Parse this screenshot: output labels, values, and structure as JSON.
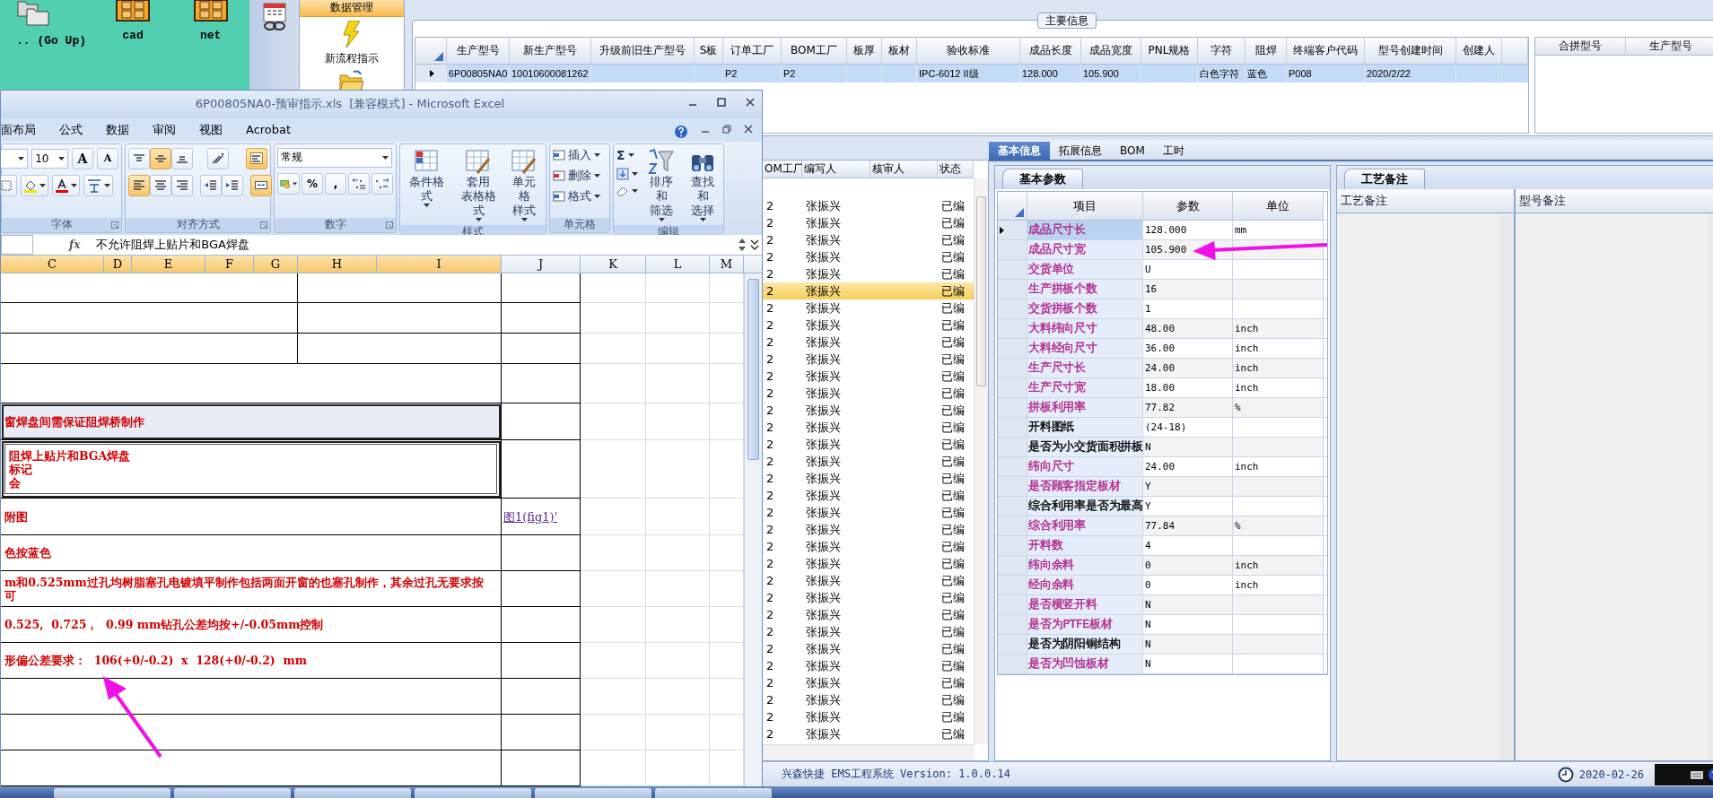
{
  "desktop": {
    "icons": [
      {
        "label": ".. (Go Up)",
        "kind": "folders"
      },
      {
        "label": "cad",
        "kind": "cabinet"
      },
      {
        "label": "net",
        "kind": "cabinet"
      }
    ]
  },
  "nav": {
    "header": "数据管理",
    "items": [
      {
        "label": "新流程指示",
        "kind": "flash"
      },
      {
        "kind": "folder"
      }
    ]
  },
  "main_info": {
    "title": "主要信息",
    "row_selected": true,
    "columns": [
      {
        "label": "生产型号",
        "value": "6P00805NA0"
      },
      {
        "label": "新生产型号",
        "value": "10010600081262"
      },
      {
        "label": "升级前旧生产型号"
      },
      {
        "label": "S板"
      },
      {
        "label": "订单工厂",
        "value": "P2"
      },
      {
        "label": "BOM工厂",
        "value": "P2"
      },
      {
        "label": "板厚"
      },
      {
        "label": "板材"
      },
      {
        "label": "验收标准",
        "value": "IPC-6012 II级"
      },
      {
        "label": "成品长度",
        "value": "128.000"
      },
      {
        "label": "成品宽度",
        "value": "105.900"
      },
      {
        "label": "PNL规格"
      },
      {
        "label": "字符",
        "value": "白色字符"
      },
      {
        "label": "阻焊",
        "value": "蓝色"
      },
      {
        "label": "终端客户代码",
        "value": "P008"
      },
      {
        "label": "型号创建时间",
        "value": "2020/2/22"
      },
      {
        "label": "创建人"
      }
    ]
  },
  "merge_table": {
    "columns": [
      "合拼型号",
      "生产型号"
    ]
  },
  "list": {
    "columns": [
      "OM工厂",
      "编写人",
      "核审人",
      "状态"
    ],
    "rows": [
      {
        "bom": "2",
        "author": "张振兴",
        "status": "已编",
        "selected": false
      },
      {
        "bom": "2",
        "author": "张振兴",
        "status": "已编",
        "selected": false
      },
      {
        "bom": "2",
        "author": "张振兴",
        "status": "已编",
        "selected": false
      },
      {
        "bom": "2",
        "author": "张振兴",
        "status": "已编",
        "selected": false
      },
      {
        "bom": "2",
        "author": "张振兴",
        "status": "已编",
        "selected": false
      },
      {
        "bom": "2",
        "author": "张振兴",
        "status": "已编",
        "selected": true
      },
      {
        "bom": "2",
        "author": "张振兴",
        "status": "已编",
        "selected": false
      },
      {
        "bom": "2",
        "author": "张振兴",
        "status": "已编",
        "selected": false
      },
      {
        "bom": "2",
        "author": "张振兴",
        "status": "已编",
        "selected": false
      },
      {
        "bom": "2",
        "author": "张振兴",
        "status": "已编",
        "selected": false
      },
      {
        "bom": "2",
        "author": "张振兴",
        "status": "已编",
        "selected": false
      },
      {
        "bom": "2",
        "author": "张振兴",
        "status": "已编",
        "selected": false
      },
      {
        "bom": "2",
        "author": "张振兴",
        "status": "已编",
        "selected": false
      },
      {
        "bom": "2",
        "author": "张振兴",
        "status": "已编",
        "selected": false
      },
      {
        "bom": "2",
        "author": "张振兴",
        "status": "已编",
        "selected": false
      },
      {
        "bom": "2",
        "author": "张振兴",
        "status": "已编",
        "selected": false
      },
      {
        "bom": "2",
        "author": "张振兴",
        "status": "已编",
        "selected": false
      },
      {
        "bom": "2",
        "author": "张振兴",
        "status": "已编",
        "selected": false
      },
      {
        "bom": "2",
        "author": "张振兴",
        "status": "已编",
        "selected": false
      },
      {
        "bom": "2",
        "author": "张振兴",
        "status": "已编",
        "selected": false
      },
      {
        "bom": "2",
        "author": "张振兴",
        "status": "已编",
        "selected": false
      },
      {
        "bom": "2",
        "author": "张振兴",
        "status": "已编",
        "selected": false
      },
      {
        "bom": "2",
        "author": "张振兴",
        "status": "已编",
        "selected": false
      },
      {
        "bom": "2",
        "author": "张振兴",
        "status": "已编",
        "selected": false
      },
      {
        "bom": "2",
        "author": "张振兴",
        "status": "已编",
        "selected": false
      },
      {
        "bom": "2",
        "author": "张振兴",
        "status": "已编",
        "selected": false
      },
      {
        "bom": "2",
        "author": "张振兴",
        "status": "已编",
        "selected": false
      },
      {
        "bom": "2",
        "author": "张振兴",
        "status": "已编",
        "selected": false
      },
      {
        "bom": "2",
        "author": "张振兴",
        "status": "已编",
        "selected": false
      },
      {
        "bom": "2",
        "author": "张振兴",
        "status": "已编",
        "selected": false
      },
      {
        "bom": "2",
        "author": "张振兴",
        "status": "已编",
        "selected": false
      },
      {
        "bom": "2",
        "author": "张振兴",
        "status": "已编",
        "selected": false
      }
    ]
  },
  "detail_tabs": [
    {
      "label": "基本信息",
      "selected": true
    },
    {
      "label": "拓展信息",
      "selected": false
    },
    {
      "label": "BOM",
      "selected": false
    },
    {
      "label": "工时",
      "selected": false
    }
  ],
  "params": {
    "tab": "基本参数",
    "columns": [
      "项目",
      "参数",
      "单位"
    ],
    "rows": [
      {
        "name": "成品尺寸长",
        "value": "128.000",
        "unit": "mm",
        "color": "#b0278c",
        "selected": true
      },
      {
        "name": "成品尺寸宽",
        "value": "105.900",
        "color": "#b0278c",
        "selected": false
      },
      {
        "name": "交货单位",
        "value": "U",
        "color": "#b0278c",
        "selected": false
      },
      {
        "name": "生产拼板个数",
        "value": "16",
        "color": "#b0278c",
        "selected": false
      },
      {
        "name": "交货拼板个数",
        "value": "1",
        "color": "#b0278c",
        "selected": false
      },
      {
        "name": "大料纬向尺寸",
        "value": "48.00",
        "unit": "inch",
        "color": "#b0278c",
        "selected": false
      },
      {
        "name": "大料经向尺寸",
        "value": "36.00",
        "unit": "inch",
        "color": "#b0278c",
        "selected": false
      },
      {
        "name": "生产尺寸长",
        "value": "24.00",
        "unit": "inch",
        "color": "#b0278c",
        "selected": false
      },
      {
        "name": "生产尺寸宽",
        "value": "18.00",
        "unit": "inch",
        "color": "#b0278c",
        "selected": false
      },
      {
        "name": "拼板利用率",
        "value": "77.82",
        "unit": "%",
        "color": "#b0278c",
        "selected": false
      },
      {
        "name": "开料图纸",
        "value": "(24-18)",
        "color": "#000000",
        "selected": false
      },
      {
        "name": "是否为小交货面积拼板",
        "value": "N",
        "color": "#000000",
        "selected": false
      },
      {
        "name": "纬向尺寸",
        "value": "24.00",
        "unit": "inch",
        "color": "#b0278c",
        "selected": false
      },
      {
        "name": "是否顾客指定板材",
        "value": "Y",
        "color": "#b0278c",
        "selected": false
      },
      {
        "name": "综合利用率是否为最高",
        "value": "Y",
        "color": "#000000",
        "selected": false
      },
      {
        "name": "综合利用率",
        "value": "77.84",
        "unit": "%",
        "color": "#b0278c",
        "selected": false
      },
      {
        "name": "开料数",
        "value": "4",
        "color": "#b0278c",
        "selected": false
      },
      {
        "name": "纬向余料",
        "value": "0",
        "unit": "inch",
        "color": "#b0278c",
        "selected": false
      },
      {
        "name": "经向余料",
        "value": "0",
        "unit": "inch",
        "color": "#b0278c",
        "selected": false
      },
      {
        "name": "是否横竖开料",
        "value": "N",
        "color": "#b0278c",
        "selected": false
      },
      {
        "name": "是否为PTFE板材",
        "value": "N",
        "color": "#b0278c",
        "selected": false
      },
      {
        "name": "是否为阴阳铜结构",
        "value": "N",
        "color": "#000000",
        "selected": false
      },
      {
        "name": "是否为凹蚀板材",
        "value": "N",
        "color": "#b0278c",
        "selected": false
      }
    ]
  },
  "notes": {
    "tab": "工艺备注",
    "columns": [
      "工艺备注",
      "型号备注"
    ]
  },
  "status_bar": {
    "text": "兴森快捷 EMS工程系统 Version: 1.0.0.14",
    "date": "2020-02-26"
  },
  "excel": {
    "title": "6P00805NA0-预审指示.xls  [兼容模式] - Microsoft Excel",
    "tabs": [
      "面布局",
      "公式",
      "数据",
      "审阅",
      "视图",
      "Acrobat"
    ],
    "groups": [
      {
        "kind": "font",
        "label": "字体"
      },
      {
        "kind": "align",
        "label": "对齐方式"
      },
      {
        "kind": "number",
        "label": "数字"
      },
      {
        "kind": "styles",
        "label": "样式"
      },
      {
        "kind": "cells",
        "label": "单元格"
      },
      {
        "kind": "editing",
        "label": "编辑"
      }
    ],
    "font_size": "10",
    "font_buttons": [
      "A",
      "A"
    ],
    "toggles": [
      {
        "kind": "valign-top",
        "selected": false
      },
      {
        "kind": "valign-middle",
        "selected": true
      },
      {
        "kind": "valign-bottom",
        "selected": false
      },
      {
        "kind": "orientation",
        "selected": false
      },
      {
        "kind": "wrap",
        "selected": true
      },
      {
        "kind": "align-left",
        "selected": true
      },
      {
        "kind": "align-center",
        "selected": false
      },
      {
        "kind": "align-right",
        "selected": false
      },
      {
        "kind": "indent-less",
        "selected": false
      },
      {
        "kind": "indent-more",
        "selected": false
      },
      {
        "kind": "merge",
        "selected": true
      }
    ],
    "number_format": "常规",
    "number_buttons": [
      "%",
      ","
    ],
    "style_buttons": [
      {
        "lines": [
          "条件格式"
        ],
        "kind": "conditional"
      },
      {
        "lines": [
          "套用",
          "表格格式"
        ],
        "kind": "table"
      },
      {
        "lines": [
          "单元格",
          "样式"
        ],
        "kind": "cell-style"
      }
    ],
    "cell_buttons": [
      "插入",
      "删除",
      "格式"
    ],
    "sum": "Σ",
    "edit_buttons": [
      {
        "lines": [
          "排序和",
          "筛选"
        ],
        "kind": "sort"
      },
      {
        "lines": [
          "查找和",
          "选择"
        ],
        "kind": "find"
      }
    ],
    "formula_label": "fx",
    "formula": "不允许阻焊上贴片和BGA焊盘",
    "columns": [
      {
        "label": "C",
        "selected": true
      },
      {
        "label": "D",
        "selected": true
      },
      {
        "label": "E",
        "selected": true
      },
      {
        "label": "F",
        "selected": true
      },
      {
        "label": "G",
        "selected": true
      },
      {
        "label": "H",
        "selected": true
      },
      {
        "label": "I",
        "selected": true
      },
      {
        "label": "J",
        "selected": false
      },
      {
        "label": "K",
        "selected": false
      },
      {
        "label": "L",
        "selected": false
      },
      {
        "label": "M",
        "selected": false
      }
    ],
    "rows": [
      {
        "kind": "split",
        "selected": false,
        "active": false
      },
      {
        "kind": "split",
        "selected": false,
        "active": false
      },
      {
        "kind": "split",
        "selected": false,
        "active": false
      },
      {
        "kind": "wide",
        "selected": false,
        "active": false
      },
      {
        "kind": "wide",
        "lines": [
          "窗焊盘间需保证阻焊桥制作"
        ],
        "selected": true,
        "active": false
      },
      {
        "kind": "wide",
        "lines": [
          "阻焊上贴片和BGA焊盘",
          "标记",
          "会"
        ],
        "selected": true,
        "active": true
      },
      {
        "kind": "wide",
        "lines": [
          "附图"
        ],
        "link": "图1(fig1)'",
        "selected": false,
        "active": false
      },
      {
        "kind": "wide",
        "lines": [
          "色按蓝色"
        ],
        "selected": false,
        "active": false
      },
      {
        "kind": "wide",
        "lines": [
          "m和0.525mm过孔均树脂塞孔电镀填平制作包括两面开窗的也塞孔制作，其余过孔无要求按",
          "可"
        ],
        "selected": false,
        "active": false
      },
      {
        "kind": "wide",
        "lines": [
          "0.525,  0.725，  0.99 mm钻孔公差均按+/-0.05mm控制"
        ],
        "selected": false,
        "active": false
      },
      {
        "kind": "wide",
        "lines": [
          "形偏公差要求：  106(+0/-0.2)  x  128(+0/-0.2)  mm"
        ],
        "selected": false,
        "active": false
      },
      {
        "kind": "wide",
        "selected": false,
        "active": false
      },
      {
        "kind": "wide",
        "selected": false,
        "active": false
      },
      {
        "kind": "wide",
        "selected": false,
        "active": false
      }
    ]
  }
}
